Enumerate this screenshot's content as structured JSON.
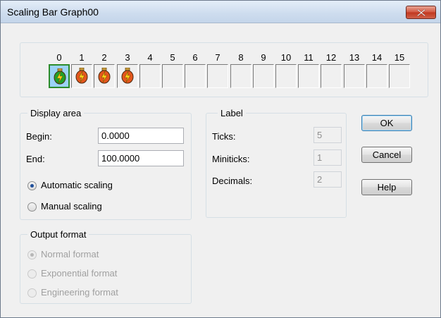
{
  "window": {
    "title": "Scaling Bar Graph00"
  },
  "bar_slots": [
    {
      "label": "0",
      "state": "green-bolt"
    },
    {
      "label": "1",
      "state": "red-bolt"
    },
    {
      "label": "2",
      "state": "red-bolt"
    },
    {
      "label": "3",
      "state": "red-bolt"
    },
    {
      "label": "4",
      "state": "empty"
    },
    {
      "label": "5",
      "state": "empty"
    },
    {
      "label": "6",
      "state": "empty"
    },
    {
      "label": "7",
      "state": "empty"
    },
    {
      "label": "8",
      "state": "empty"
    },
    {
      "label": "9",
      "state": "empty"
    },
    {
      "label": "10",
      "state": "empty"
    },
    {
      "label": "11",
      "state": "empty"
    },
    {
      "label": "12",
      "state": "empty"
    },
    {
      "label": "13",
      "state": "empty"
    },
    {
      "label": "14",
      "state": "empty"
    },
    {
      "label": "15",
      "state": "empty"
    }
  ],
  "display_area": {
    "title": "Display area",
    "begin_label": "Begin:",
    "begin_value": "0.0000",
    "end_label": "End:",
    "end_value": "100.0000",
    "auto_scaling": "Automatic scaling",
    "manual_scaling": "Manual scaling",
    "selected": "auto"
  },
  "label_group": {
    "title": "Label",
    "ticks_label": "Ticks:",
    "ticks_value": "5",
    "miniticks_label": "Miniticks:",
    "miniticks_value": "1",
    "decimals_label": "Decimals:",
    "decimals_value": "2"
  },
  "output_format": {
    "title": "Output format",
    "normal": "Normal format",
    "exponential": "Exponential format",
    "engineering": "Engineering format",
    "selected": "normal"
  },
  "buttons": {
    "ok": "OK",
    "cancel": "Cancel",
    "help": "Help"
  },
  "colors": {
    "bolt_green": "#22a12a",
    "bolt_red": "#e4561d",
    "bolt_yellow": "#ffd21a",
    "accent": "#3c7fb1"
  }
}
